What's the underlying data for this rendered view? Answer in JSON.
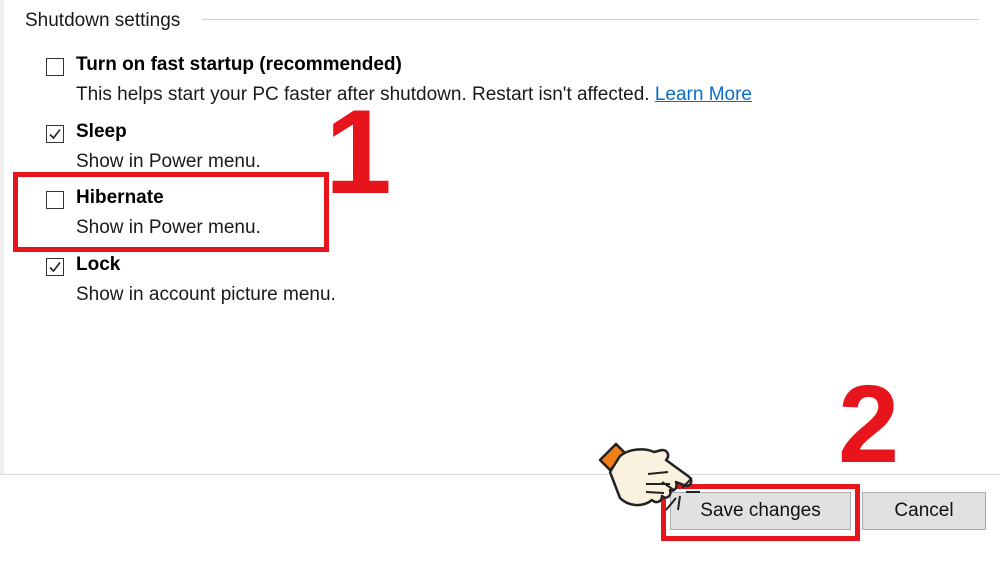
{
  "group": {
    "title": "Shutdown settings"
  },
  "options": [
    {
      "label": "Turn on fast startup (recommended)",
      "checked": false,
      "description": "This helps start your PC faster after shutdown. Restart isn't affected.",
      "link": "Learn More"
    },
    {
      "label": "Sleep",
      "checked": true,
      "description": "Show in Power menu."
    },
    {
      "label": "Hibernate",
      "checked": false,
      "description": "Show in Power menu."
    },
    {
      "label": "Lock",
      "checked": true,
      "description": "Show in account picture menu."
    }
  ],
  "annotations": {
    "step1": "1",
    "step2": "2",
    "color": "#e8141b"
  },
  "buttons": {
    "save": "Save changes",
    "cancel": "Cancel"
  },
  "icons": {
    "checkbox_check": "checkmark-icon",
    "pointer": "pointing-hand-icon"
  }
}
